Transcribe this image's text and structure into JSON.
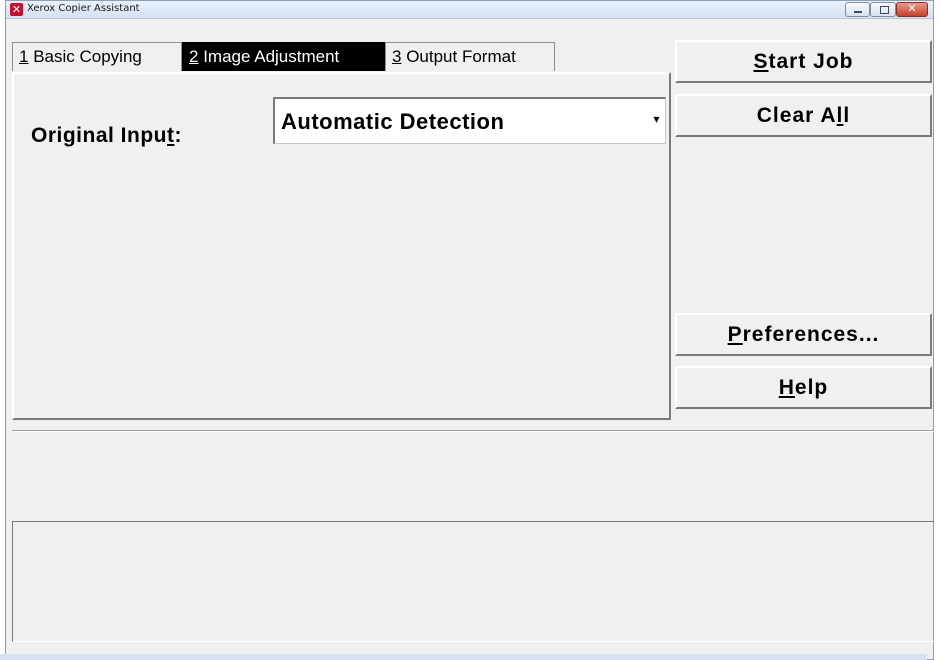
{
  "window": {
    "title": "Xerox Copier Assistant",
    "icon": "xerox-app-icon",
    "controls": {
      "minimize": "minimize-icon",
      "maximize": "maximize-icon",
      "close": "close-icon"
    }
  },
  "tabs": [
    {
      "number": "1",
      "label": " Basic Copying",
      "selected": false
    },
    {
      "number": "2",
      "label": " Image Adjustment",
      "selected": true
    },
    {
      "number": "3",
      "label": " Output Format",
      "selected": false
    }
  ],
  "panel": {
    "original_input_label_pre": "Original Inpu",
    "original_input_label_u": "t",
    "original_input_label_post": ":",
    "original_input_value": "Automatic Detection"
  },
  "buttons": {
    "start_job": {
      "u": "S",
      "rest": "tart Job"
    },
    "clear_all": {
      "pre": "Clear A",
      "u": "l",
      "post": "l"
    },
    "preferences": {
      "u": "P",
      "rest": "references..."
    },
    "help": {
      "u": "H",
      "rest": "elp"
    }
  },
  "colors": {
    "selected_tab_bg": "#000000",
    "selected_tab_fg": "#ffffff",
    "close_button": "#c6402a"
  }
}
